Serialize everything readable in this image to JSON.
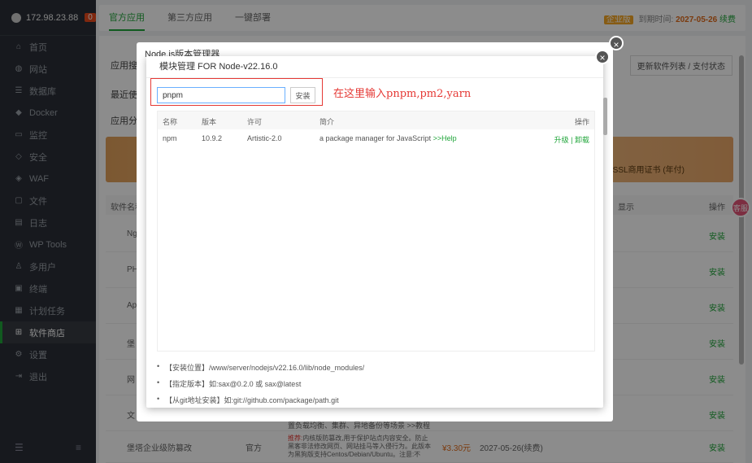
{
  "sidebar": {
    "host": "172.98.23.88",
    "badge": "0",
    "items": [
      {
        "label": "首页",
        "icon": "home-icon"
      },
      {
        "label": "网站",
        "icon": "globe-icon"
      },
      {
        "label": "数据库",
        "icon": "database-icon"
      },
      {
        "label": "Docker",
        "icon": "docker-icon"
      },
      {
        "label": "监控",
        "icon": "monitor-icon"
      },
      {
        "label": "安全",
        "icon": "shield-icon"
      },
      {
        "label": "WAF",
        "icon": "waf-icon"
      },
      {
        "label": "文件",
        "icon": "folder-icon"
      },
      {
        "label": "日志",
        "icon": "log-icon"
      },
      {
        "label": "WP Tools",
        "icon": "wordpress-icon"
      },
      {
        "label": "多用户",
        "icon": "users-icon"
      },
      {
        "label": "终端",
        "icon": "terminal-icon"
      },
      {
        "label": "计划任务",
        "icon": "calendar-icon"
      },
      {
        "label": "软件商店",
        "icon": "grid-icon"
      },
      {
        "label": "设置",
        "icon": "gear-icon"
      },
      {
        "label": "退出",
        "icon": "logout-icon"
      }
    ]
  },
  "topbar": {
    "tabs": [
      "官方应用",
      "第三方应用",
      "一键部署"
    ],
    "enterprise": "企业版",
    "expire_label": "到期时间:",
    "expire_date": "2027-05-26",
    "renew": "续费"
  },
  "background": {
    "search_label": "应用搜索",
    "recent_label": "最近使用",
    "category_label": "应用分类",
    "update_btn": "更新软件列表 / 支付状态",
    "banner_text": "SSL商用证书 (年付)",
    "col_name": "软件名称",
    "col_display": "显示",
    "col_ops": "操作",
    "rows": [
      {
        "name": "Ng",
        "action": "安装"
      },
      {
        "name": "PH",
        "action": "安装"
      },
      {
        "name": "Ap",
        "action": "安装"
      },
      {
        "name": "堡",
        "action": "安装"
      },
      {
        "name": "网",
        "action": "安装"
      },
      {
        "name": "文",
        "action": "安装"
      },
      {
        "name": "堡塔企业级防篡改",
        "action": "安装"
      }
    ],
    "row6_desc": "置负载均衡、集群、异地备份等场景 >>教程",
    "row7_desc_prefix": "推荐:",
    "row7_desc": "内核版防篡改,用于保护站点内容安全。防止黑客非法修改网页、网站挂马等入侵行为。此版本为黑狗版支持Centos/Debian/Ubuntu。注意:不",
    "row7_dev": "官方",
    "row7_price": "¥3.30元",
    "row7_date": "2027-05-26(续费)"
  },
  "dialog_back": {
    "title": "Node.js版本管理器"
  },
  "dialog": {
    "title": "模块管理 FOR Node-v22.16.0",
    "input_value": "pnpm",
    "install_btn": "安装",
    "hint": "在这里输入pnpm,pm2,yarn",
    "headers": {
      "name": "名称",
      "version": "版本",
      "license": "许可",
      "desc": "简介",
      "ops": "操作"
    },
    "rows": [
      {
        "name": "npm",
        "version": "10.9.2",
        "license": "Artistic-2.0",
        "desc": "a package manager for JavaScript",
        "help": ">>Help",
        "upgrade": "升级",
        "sep": "|",
        "uninstall": "卸载"
      }
    ],
    "notes": [
      "【安装位置】/www/server/nodejs/v22.16.0/lib/node_modules/",
      "【指定版本】如:sax@0.2.0 或 sax@latest",
      "【从git地址安装】如:git://github.com/package/path.git"
    ]
  },
  "float_btn": "客服"
}
